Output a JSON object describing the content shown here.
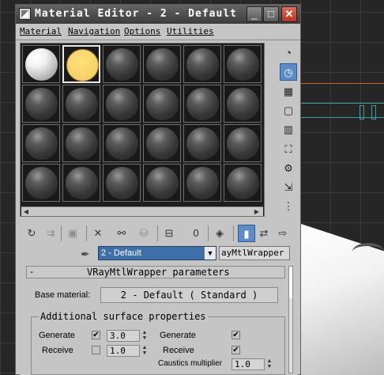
{
  "window": {
    "title": "Material Editor - 2 - Default",
    "controls": {
      "minimize": "_",
      "maximize": "□",
      "close": "✕"
    }
  },
  "menu": {
    "items": [
      {
        "label": "Material"
      },
      {
        "label": "Navigation"
      },
      {
        "label": "Options"
      },
      {
        "label": "Utilities"
      }
    ]
  },
  "slots": {
    "rows": 4,
    "cols": 6,
    "items": [
      {
        "style": "white"
      },
      {
        "style": "yellow",
        "active": true
      },
      {
        "style": "gray"
      },
      {
        "style": "gray"
      },
      {
        "style": "gray"
      },
      {
        "style": "gray"
      },
      {
        "style": "gray"
      },
      {
        "style": "gray"
      },
      {
        "style": "gray"
      },
      {
        "style": "gray"
      },
      {
        "style": "gray"
      },
      {
        "style": "gray"
      },
      {
        "style": "gray"
      },
      {
        "style": "gray"
      },
      {
        "style": "gray"
      },
      {
        "style": "gray"
      },
      {
        "style": "gray"
      },
      {
        "style": "gray"
      },
      {
        "style": "gray"
      },
      {
        "style": "gray"
      },
      {
        "style": "gray"
      },
      {
        "style": "gray"
      },
      {
        "style": "gray"
      },
      {
        "style": "gray"
      }
    ]
  },
  "side_tools": [
    {
      "icon": "sample-type-icon",
      "glyph": "◔"
    },
    {
      "icon": "backlight-icon",
      "glyph": "◷",
      "active": true
    },
    {
      "icon": "background-checker-icon",
      "glyph": "▦"
    },
    {
      "icon": "sample-uv-tiling-icon",
      "glyph": "▢"
    },
    {
      "icon": "video-color-check-icon",
      "glyph": "▥"
    },
    {
      "icon": "make-preview-icon",
      "glyph": "⛶"
    },
    {
      "icon": "options-icon",
      "glyph": "⚙"
    },
    {
      "icon": "select-by-material-icon",
      "glyph": "⇲"
    },
    {
      "icon": "material-map-navigator-icon",
      "glyph": "⋮"
    }
  ],
  "toolbar": [
    {
      "icon": "get-material-icon",
      "glyph": "↻"
    },
    {
      "icon": "put-to-scene-icon",
      "glyph": "⇉",
      "dim": true
    },
    {
      "icon": "assign-to-selection-icon",
      "glyph": "▣",
      "dim": true
    },
    {
      "icon": "reset-map-icon",
      "glyph": "✕"
    },
    {
      "icon": "make-unique-icon",
      "glyph": "⚯"
    },
    {
      "icon": "put-to-library-icon",
      "glyph": "⛁",
      "dim": true
    },
    {
      "icon": "material-id-channel-icon",
      "glyph": "⊟"
    },
    {
      "icon": "show-map-in-viewport-icon",
      "glyph": "0"
    },
    {
      "icon": "show-end-result-icon",
      "glyph": "◈"
    },
    {
      "icon": "go-to-parent-icon",
      "glyph": "▮",
      "active": true
    },
    {
      "icon": "go-forward-to-sibling-icon",
      "glyph": "⇄"
    },
    {
      "icon": "go-sibling-icon",
      "glyph": "⇨"
    }
  ],
  "material": {
    "name": "2 - Default",
    "type": "ayMtlWrapper"
  },
  "rollout": {
    "title": "VRayMtlWrapper parameters",
    "base_material_label": "Base material:",
    "base_material_value": "2 - Default  ( Standard )",
    "group_title": "Additional surface properties",
    "generate_label": "Generate",
    "generate_value": "3.0",
    "receive_label": "Receive",
    "receive_value": "1.0",
    "generate2_label": "Generate",
    "receive2_label": "Receive",
    "caustics_label": "Caustics multiplier",
    "caustics_value": "1.0",
    "generate_checked": true,
    "receive_checked": false,
    "generate2_checked": true,
    "receive2_checked": true
  }
}
